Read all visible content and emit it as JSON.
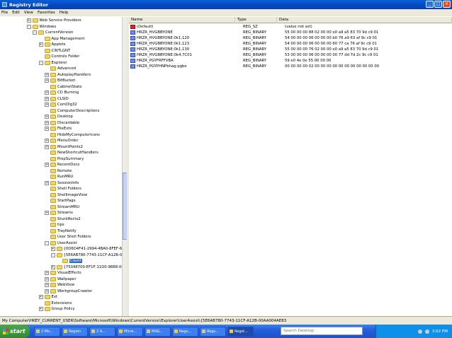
{
  "window": {
    "title": "Registry Editor"
  },
  "menu": [
    "File",
    "Edit",
    "View",
    "Favorites",
    "Help"
  ],
  "tree": [
    {
      "label": "Web Service Providers",
      "exp": "+",
      "depth": 3
    },
    {
      "label": "Windows",
      "exp": "-",
      "depth": 3
    },
    {
      "label": "CurrentVersion",
      "exp": "-",
      "depth": 4
    },
    {
      "label": "App Management",
      "exp": "",
      "depth": 5
    },
    {
      "label": "Applets",
      "exp": "+",
      "depth": 5
    },
    {
      "label": "CINTLGNT",
      "exp": "",
      "depth": 5
    },
    {
      "label": "Controls Folder",
      "exp": "",
      "depth": 5
    },
    {
      "label": "Explorer",
      "exp": "-",
      "depth": 5
    },
    {
      "label": "Advanced",
      "exp": "",
      "depth": 6
    },
    {
      "label": "AutoplayHandlers",
      "exp": "+",
      "depth": 6
    },
    {
      "label": "BitBucket",
      "exp": "+",
      "depth": 6
    },
    {
      "label": "CabinetState",
      "exp": "",
      "depth": 6
    },
    {
      "label": "CD Burning",
      "exp": "+",
      "depth": 6
    },
    {
      "label": "CLSID",
      "exp": "+",
      "depth": 6
    },
    {
      "label": "ComDlg32",
      "exp": "+",
      "depth": 6
    },
    {
      "label": "ComputerDescriptions",
      "exp": "",
      "depth": 6
    },
    {
      "label": "Desktop",
      "exp": "+",
      "depth": 6
    },
    {
      "label": "Discardable",
      "exp": "+",
      "depth": 6
    },
    {
      "label": "FileExts",
      "exp": "+",
      "depth": 6
    },
    {
      "label": "HideMyComputerIcons",
      "exp": "",
      "depth": 6
    },
    {
      "label": "MenuOrder",
      "exp": "+",
      "depth": 6
    },
    {
      "label": "MountPoints2",
      "exp": "+",
      "depth": 6
    },
    {
      "label": "NewShortcutHandlers",
      "exp": "",
      "depth": 6
    },
    {
      "label": "PropSummary",
      "exp": "",
      "depth": 6
    },
    {
      "label": "RecentDocs",
      "exp": "+",
      "depth": 6
    },
    {
      "label": "Remote",
      "exp": "",
      "depth": 6
    },
    {
      "label": "RunMRU",
      "exp": "",
      "depth": 6
    },
    {
      "label": "SessionInfo",
      "exp": "+",
      "depth": 6
    },
    {
      "label": "Shell Folders",
      "exp": "",
      "depth": 6
    },
    {
      "label": "ShellImageView",
      "exp": "",
      "depth": 6
    },
    {
      "label": "StartPage",
      "exp": "",
      "depth": 6
    },
    {
      "label": "StreamMRU",
      "exp": "",
      "depth": 6
    },
    {
      "label": "Streams",
      "exp": "+",
      "depth": 6
    },
    {
      "label": "StuckRects2",
      "exp": "",
      "depth": 6
    },
    {
      "label": "tips",
      "exp": "",
      "depth": 6
    },
    {
      "label": "TrayNotify",
      "exp": "",
      "depth": 6
    },
    {
      "label": "User Shell Folders",
      "exp": "",
      "depth": 6
    },
    {
      "label": "UserAssist",
      "exp": "-",
      "depth": 6
    },
    {
      "label": "{0D6D4F41-2994-4BA0-8FEF-620E43CD",
      "exp": "+",
      "depth": 7
    },
    {
      "label": "{5E6AB780-7743-11CF-A12B-00AA004",
      "exp": "-",
      "depth": 7
    },
    {
      "label": "Count",
      "exp": "",
      "depth": 8,
      "selected": true
    },
    {
      "label": "{75048700-EF1F-11D0-9888-006097DE",
      "exp": "+",
      "depth": 7
    },
    {
      "label": "VisualEffects",
      "exp": "+",
      "depth": 6
    },
    {
      "label": "Wallpaper",
      "exp": "+",
      "depth": 6
    },
    {
      "label": "WebView",
      "exp": "+",
      "depth": 6
    },
    {
      "label": "WorkgroupCrawler",
      "exp": "+",
      "depth": 6
    },
    {
      "label": "Ext",
      "exp": "+",
      "depth": 5
    },
    {
      "label": "Extensions",
      "exp": "",
      "depth": 5
    },
    {
      "label": "Group Policy",
      "exp": "+",
      "depth": 5
    }
  ],
  "columns": {
    "name": "Name",
    "type": "Type",
    "data": "Data"
  },
  "values": [
    {
      "name": "(Default)",
      "type": "REG_SZ",
      "data": "(value not set)",
      "icon": "string-value-icon"
    },
    {
      "name": "HRZR_HVGBBYONE",
      "type": "REG_BINARY",
      "data": "55 00 00 00 88 02 00 00 e0 a9 a5 83 70 9d c9 01"
    },
    {
      "name": "HRZR_HVGBBYONE:0k1,120",
      "type": "REG_BINARY",
      "data": "54 00 00 00 06 00 00 00 b0 76 a9 63 af 9c c9 01"
    },
    {
      "name": "HRZR_HVGBBYONE:0k1,123",
      "type": "REG_BINARY",
      "data": "54 00 00 00 06 00 00 00 60 77 ca 76 af 9c c9 01"
    },
    {
      "name": "HRZR_HVGBBYONE:0k1,130",
      "type": "REG_BINARY",
      "data": "55 00 00 00 76 02 00 00 e0 a9 a5 83 70 9d c9 01"
    },
    {
      "name": "HRZR_HVGBBYONE:0k4,7C01",
      "type": "REG_BINARY",
      "data": "53 00 00 00 06 00 00 00 00 77 dd 7d 2c 9c c9 01"
    },
    {
      "name": "HRZR_PGYFRFFVBA",
      "type": "REG_BINARY",
      "data": "59 e0 4e 0e 55 00 00 00"
    },
    {
      "name": "HRZR_PGYPHNPbhag:pgbe",
      "type": "REG_BINARY",
      "data": "00 00 00 00 02 00 00 00 00 00 00 00 00 00 00 00"
    }
  ],
  "statusbar": "My Computer\\HKEY_CURRENT_USER\\Software\\Microsoft\\Windows\\CurrentVersion\\Explorer\\UserAssist\\{5E6AB780-7743-11CF-A12B-00AA004AE83",
  "taskbar": {
    "start": "start",
    "items": [
      "2 Mo...",
      "Region",
      "2 A...",
      "Micro...",
      "MAG...",
      "Regs...",
      "Regs...",
      "Regst..."
    ],
    "search_placeholder": "Search Desktop",
    "clock": "3:02 PM"
  }
}
